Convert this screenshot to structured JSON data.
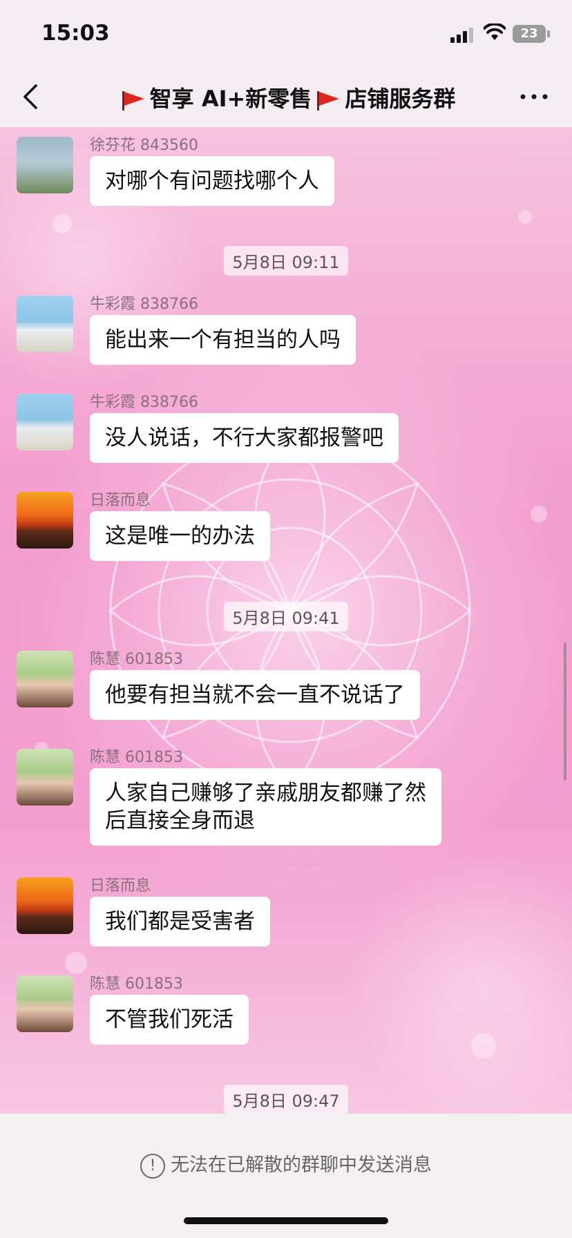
{
  "status_bar": {
    "time": "15:03",
    "battery": "23"
  },
  "header": {
    "title_left": "智享 AI+新零售",
    "title_right": "店铺服务群",
    "back_icon": "chevron-left-icon",
    "more_icon": "ellipsis-icon",
    "flag_icon": "red-flag-icon"
  },
  "messages": [
    {
      "sender": "徐芬花 843560",
      "text": "对哪个有问题找哪个人",
      "avatar": "woman-photo"
    },
    {
      "sender": "牛彩霞 838766",
      "text": "能出来一个有担当的人吗",
      "avatar": "beach-photo"
    },
    {
      "sender": "牛彩霞 838766",
      "text": "没人说话，不行大家都报警吧",
      "avatar": "beach-photo"
    },
    {
      "sender": "日落而息",
      "text": "这是唯一的办法",
      "avatar": "sunset-photo"
    },
    {
      "sender": "陈慧 601853",
      "text": "他要有担当就不会一直不说话了",
      "avatar": "girl-photo"
    },
    {
      "sender": "陈慧 601853",
      "text": "人家自己赚够了亲戚朋友都赚了然\n后直接全身而退",
      "avatar": "girl-photo"
    },
    {
      "sender": "日落而息",
      "text": "我们都是受害者",
      "avatar": "sunset-photo"
    },
    {
      "sender": "陈慧 601853",
      "text": "不管我们死活",
      "avatar": "girl-photo"
    }
  ],
  "timestamps": [
    "5月8日 09:11",
    "5月8日 09:41",
    "5月8日 09:47"
  ],
  "footer": {
    "notice": "无法在已解散的群聊中发送消息",
    "notice_icon": "exclamation-circle-icon"
  }
}
